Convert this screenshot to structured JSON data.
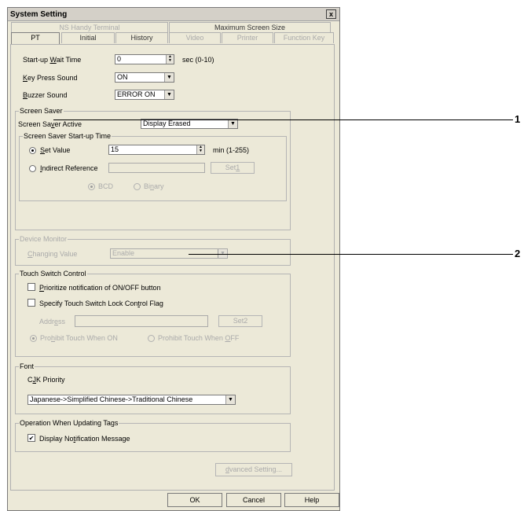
{
  "window": {
    "title": "System Setting",
    "close_glyph": "x"
  },
  "tabs_top": [
    {
      "label": "NS Handy Terminal"
    },
    {
      "label": "Maximum Screen Size"
    }
  ],
  "tabs_bottom": [
    {
      "label": "PT"
    },
    {
      "label": "Initial"
    },
    {
      "label": "History"
    },
    {
      "label": "Video"
    },
    {
      "label": "Printer"
    },
    {
      "label": "Function Key"
    }
  ],
  "startup": {
    "wait_label_pre": "Start-up ",
    "wait_label_key": "W",
    "wait_label_post": "ait Time",
    "wait_value": "0",
    "wait_unit": "sec (0-10)",
    "key_label_key": "K",
    "key_label_post": "ey Press Sound",
    "key_value": "ON",
    "buzzer_label_key": "B",
    "buzzer_label_post": "uzzer Sound",
    "buzzer_value": "ERROR ON"
  },
  "screen_saver": {
    "group_title": "Screen Saver",
    "active_label_pre": "Screen Sa",
    "active_label_key": "v",
    "active_label_post": "er Active",
    "active_value": "Display Erased",
    "startup_group_title": "Screen Saver Start-up Time",
    "set_value_key": "S",
    "set_value_post": "et Value",
    "set_value": "15",
    "set_value_unit": "min (1-255)",
    "indirect_key": "I",
    "indirect_post": "ndirect Reference",
    "indirect_value": "",
    "set1_label_pre": "Set",
    "set1_label_key": "1",
    "set1_label_post": "",
    "bcd_label": "BCD",
    "binary_label_pre": "Bi",
    "binary_label_key": "n",
    "binary_label_post": "ary"
  },
  "device_monitor": {
    "group_title": "Device Monitor",
    "changing_key": "C",
    "changing_post": "hanging Value",
    "changing_value": "Enable"
  },
  "touch_switch": {
    "group_title": "Touch Switch Control",
    "prioritize_key": "P",
    "prioritize_post": "rioritize notification of ON/OFF button",
    "specify_pre": "Specify Touch Switch Lock Con",
    "specify_key": "t",
    "specify_post": "rol Flag",
    "address_pre": "Addr",
    "address_key": "e",
    "address_post": "ss",
    "address_value": "",
    "set2_label": "Set2",
    "prohibit_on_pre": "Pro",
    "prohibit_on_key": "h",
    "prohibit_on_post": "ibit Touch When ON",
    "prohibit_off_pre": "Prohibit Touch When ",
    "prohibit_off_key": "O",
    "prohibit_off_post": "FF"
  },
  "font": {
    "group_title": "Font",
    "cjk_pre": "C",
    "cjk_key": "J",
    "cjk_post": "K Priority",
    "cjk_value": "Japanese->Simplified Chinese->Traditional Chinese"
  },
  "tags": {
    "group_title": "Operation When Updating Tags",
    "display_pre": "Display No",
    "display_key": "t",
    "display_post": "ification Message"
  },
  "advanced_pre": "A",
  "advanced_key": "d",
  "advanced_post": "vanced Setting...",
  "buttons": {
    "ok": "OK",
    "cancel": "Cancel",
    "help": "Help"
  },
  "callouts": [
    "1",
    "2"
  ]
}
